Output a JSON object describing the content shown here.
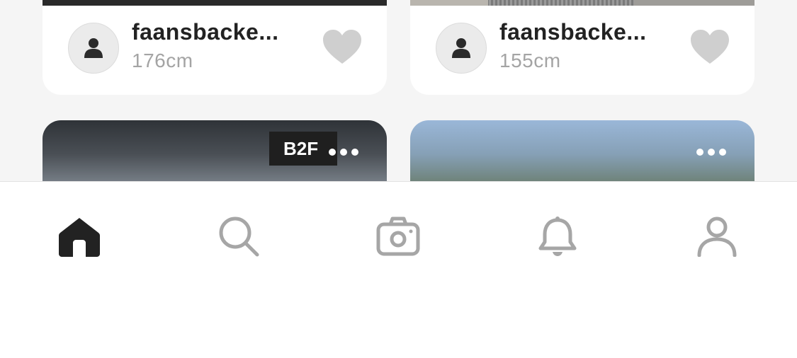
{
  "feed": {
    "cards": [
      {
        "username": "faansbacke...",
        "height": "176cm",
        "avatar_icon": "person-icon",
        "like_icon": "heart-icon"
      },
      {
        "username": "faansbacke...",
        "height": "155cm",
        "avatar_icon": "person-icon",
        "like_icon": "heart-icon"
      }
    ],
    "photos": [
      {
        "sign_text": "B2F",
        "more_icon": "more-dots-icon"
      },
      {
        "more_icon": "more-dots-icon"
      }
    ]
  },
  "tabbar": {
    "items": [
      {
        "icon": "home-icon",
        "active": true
      },
      {
        "icon": "search-icon",
        "active": false
      },
      {
        "icon": "camera-icon",
        "active": false
      },
      {
        "icon": "bell-icon",
        "active": false
      },
      {
        "icon": "profile-icon",
        "active": false
      }
    ]
  },
  "colors": {
    "background": "#f5f5f5",
    "card": "#ffffff",
    "username": "#222222",
    "height_text": "#a4a4a4",
    "heart": "#cfcfcf",
    "tab_active": "#222222",
    "tab_inactive": "#a6a6a6"
  }
}
